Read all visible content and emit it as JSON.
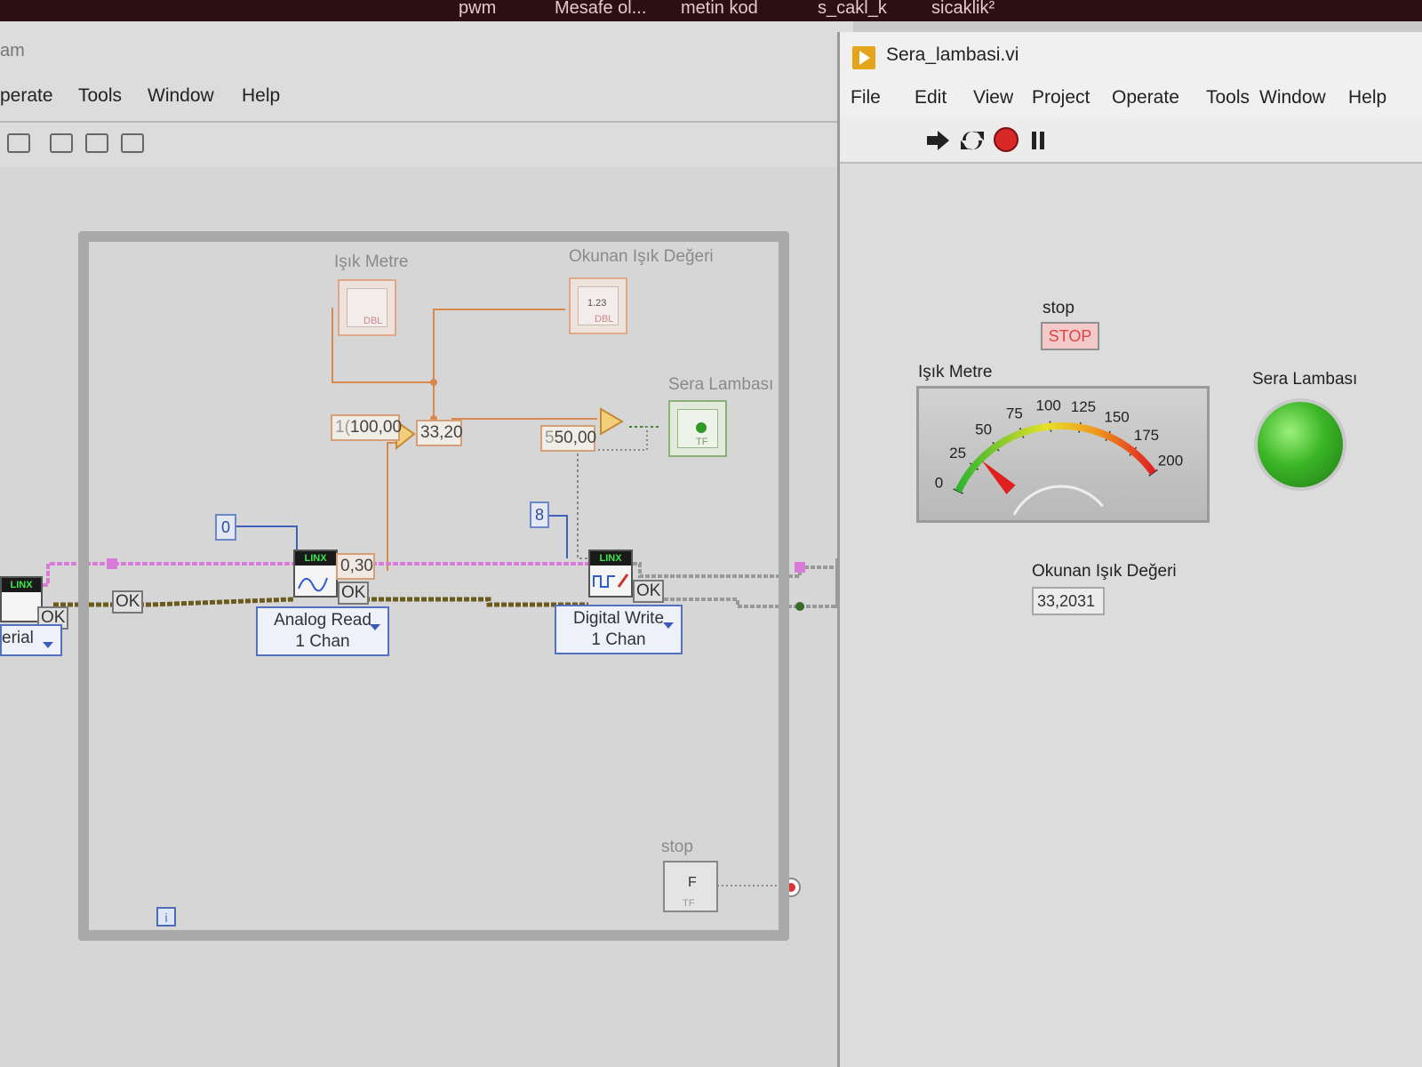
{
  "taskbar": {
    "items": [
      "pwm",
      "Mesafe ol...",
      "metin kod",
      "s_cakl_k",
      "sicaklik²"
    ]
  },
  "block_diagram": {
    "title_fragment": "am",
    "menu": [
      "perate",
      "Tools",
      "Window",
      "Help"
    ],
    "labels": {
      "isik_metre": "Işık Metre",
      "okunan_isik": "Okunan Işık Değeri",
      "sera_lambasi": "Sera Lambası",
      "stop": "stop"
    },
    "constants": {
      "mult_const": "100,00",
      "mult_const_prefix": "1(",
      "result": "33,20",
      "compare_const": "50,00",
      "compare_const_prefix": "5",
      "pin_analog": "0",
      "pin_digital": "8",
      "analog_value": "0,30"
    },
    "indicator_text": {
      "gauge_term": "DBL",
      "numeric_term": "DBL",
      "numeric_term_value": "1.23",
      "bool_term": "TF",
      "stop_term": "TF",
      "stop_term_value": "F"
    },
    "ok_labels": [
      "OK",
      "OK",
      "OK",
      "OK"
    ],
    "linx_label": "LINX",
    "analog_read": {
      "line1": "Analog Read",
      "line2": "1 Chan"
    },
    "digital_write": {
      "line1": "Digital Write",
      "line2": "1 Chan"
    },
    "serial_label": "erial",
    "iteration_label": "i"
  },
  "front_panel": {
    "title": "Sera_lambasi.vi",
    "menu": [
      "File",
      "Edit",
      "View",
      "Project",
      "Operate",
      "Tools",
      "Window",
      "Help"
    ],
    "stop_label": "stop",
    "stop_button": "STOP",
    "gauge_label": "Işık Metre",
    "gauge": {
      "min": 0,
      "max": 200,
      "value": 33.2,
      "ticks": [
        "0",
        "25",
        "50",
        "75",
        "100",
        "125",
        "150",
        "175",
        "200"
      ]
    },
    "led_label": "Sera Lambası",
    "led_state": "on",
    "led_color": "#3bb526",
    "numeric_label": "Okunan Işık Değeri",
    "numeric_value": "33,2031"
  }
}
